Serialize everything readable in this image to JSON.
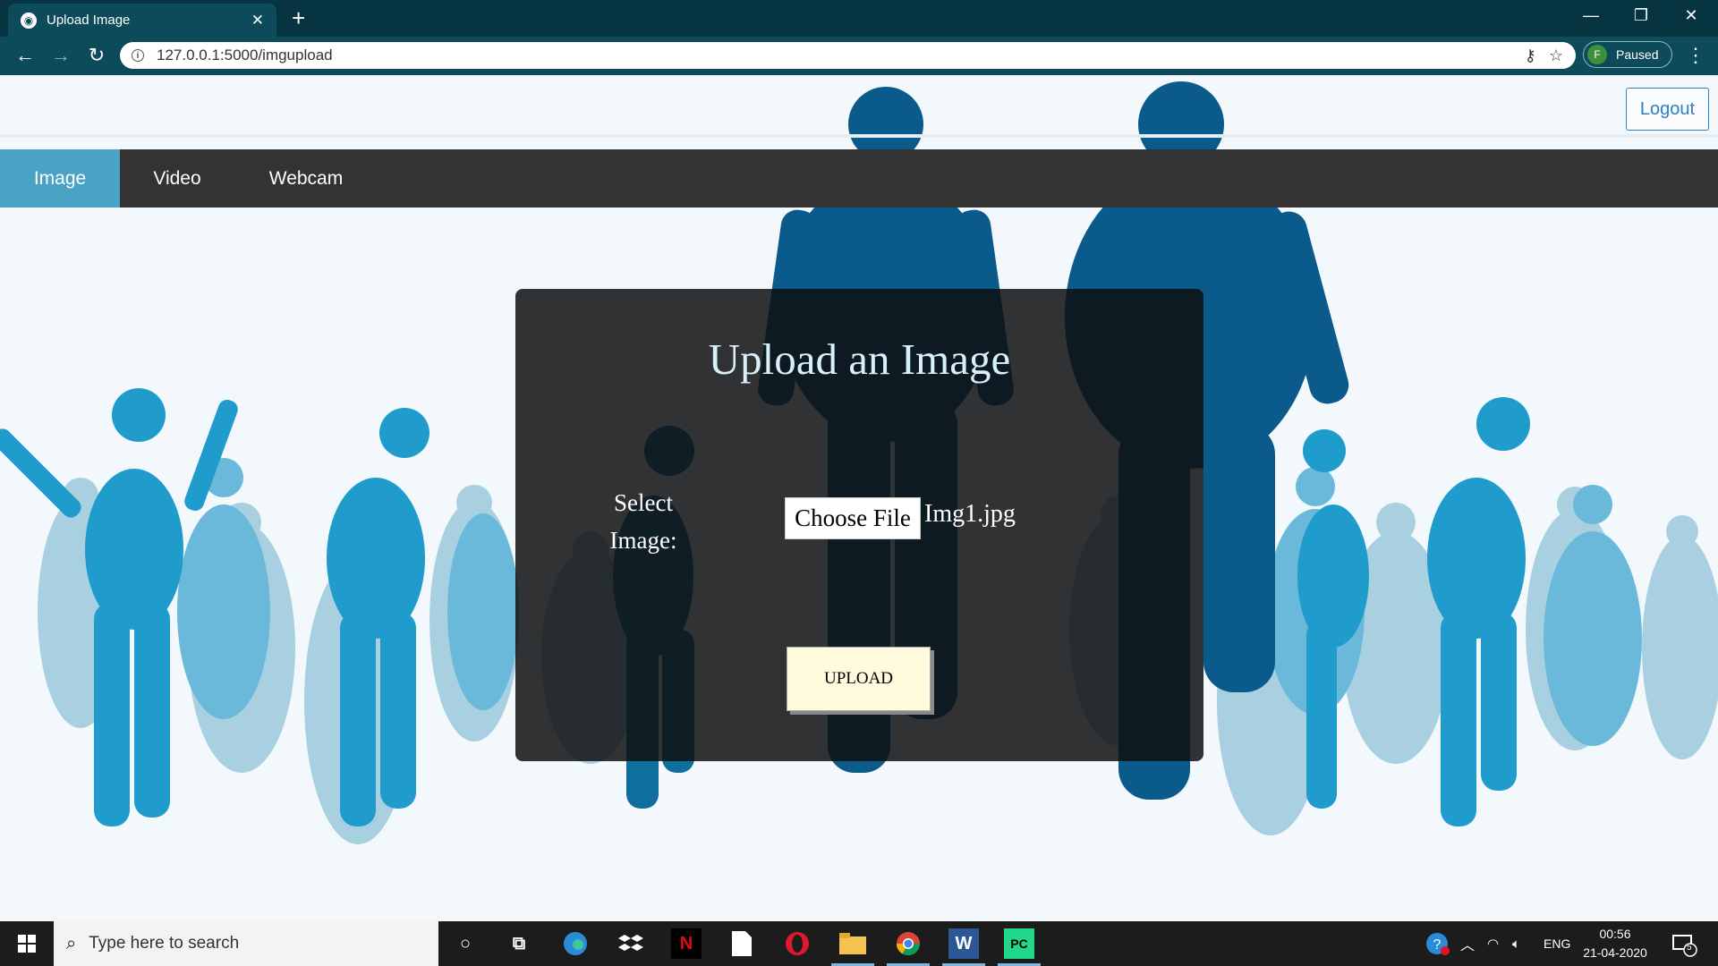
{
  "browser": {
    "tab_title": "Upload Image",
    "new_tab_icon": "plus-icon",
    "url": "127.0.0.1:5000/imgupload",
    "profile_initial": "F",
    "profile_status": "Paused",
    "theme_color": "#0d4b5b"
  },
  "header": {
    "logout_label": "Logout"
  },
  "nav": {
    "items": [
      {
        "label": "Image",
        "active": true
      },
      {
        "label": "Video",
        "active": false
      },
      {
        "label": "Webcam",
        "active": false
      }
    ],
    "active_color": "#4aa3c4"
  },
  "upload_card": {
    "title": "Upload an Image",
    "select_label_line1": "Select",
    "select_label_line2": "Image:",
    "choose_file_label": "Choose File",
    "file_name": "Img1.jpg",
    "upload_button_label": "UPLOAD"
  },
  "taskbar": {
    "search_placeholder": "Type here to search",
    "pinned_apps": [
      "task-view",
      "edge",
      "dropbox",
      "netflix",
      "file",
      "opera",
      "file-explorer",
      "chrome",
      "word",
      "pycharm"
    ],
    "language": "ENG",
    "time": "00:56",
    "date": "21-04-2020",
    "notification_count": "5"
  }
}
